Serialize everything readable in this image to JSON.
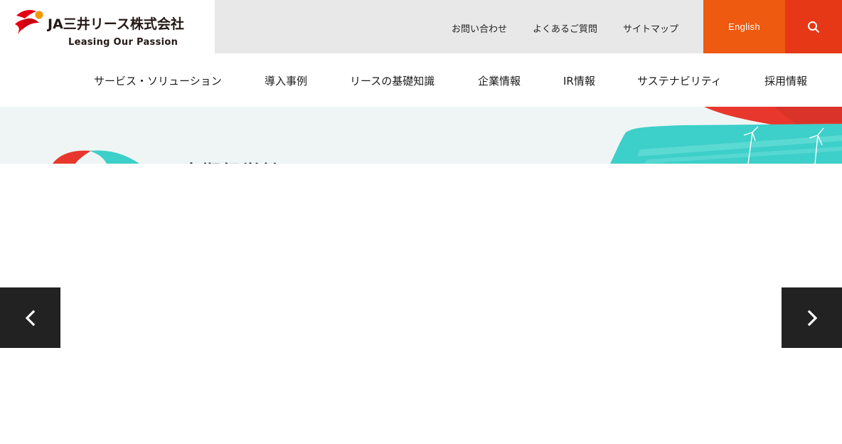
{
  "header": {
    "company_name": "JA三井リース株式会社",
    "tagline": "Leasing Our Passion",
    "utility_links": {
      "contact": "お問い合わせ",
      "faq": "よくあるご質問",
      "sitemap": "サイトマップ"
    },
    "english_label": "English",
    "colors": {
      "english_bg": "#ee5a0f",
      "search_bg": "#e63717",
      "util_bg": "#e8e8e8"
    }
  },
  "nav": {
    "items": [
      {
        "label": "サービス・ソリューション"
      },
      {
        "label": "導入事例"
      },
      {
        "label": "リースの基礎知識"
      },
      {
        "label": "企業情報"
      },
      {
        "label": "IR情報"
      },
      {
        "label": "サステナビリティ"
      },
      {
        "label": "採用情報"
      }
    ]
  },
  "hero": {
    "title": "中期経営計画",
    "colors": {
      "bg": "#eff5f5",
      "accent_red": "#e8372c",
      "accent_teal": "#3dcfc9"
    }
  },
  "carousel": {
    "prev_icon": "chevron-left-icon",
    "next_icon": "chevron-right-icon",
    "arrow_bg": "#222222"
  }
}
